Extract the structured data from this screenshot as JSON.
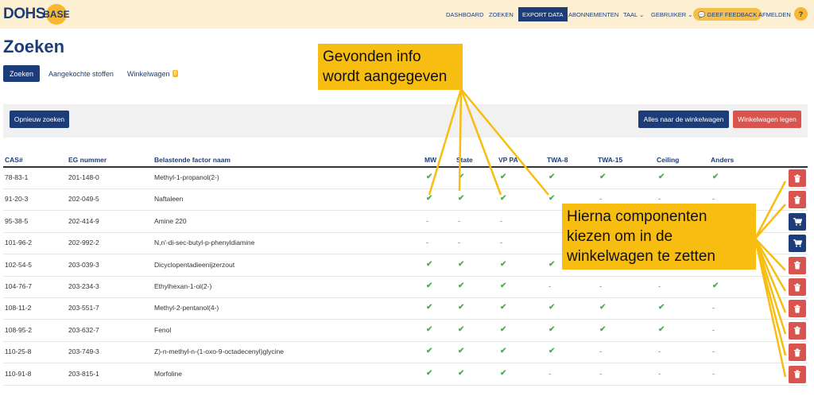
{
  "header": {
    "logo_left": "DOHS",
    "logo_middle": "BASE",
    "nav": [
      {
        "label": "DASHBOARD"
      },
      {
        "label": "ZOEKEN"
      },
      {
        "label": "EXPORT DATA"
      },
      {
        "label": "ABONNEMENTEN"
      },
      {
        "label": "TAAL ⌄"
      },
      {
        "label": "GEBRUIKER ⌄"
      },
      {
        "label": "💬 GEEF FEEDBACK"
      },
      {
        "label": "AFMELDEN"
      }
    ],
    "help": "?"
  },
  "page": {
    "title": "Zoeken"
  },
  "tabs": [
    {
      "label": "Zoeken"
    },
    {
      "label": "Aangekochte stoffen"
    },
    {
      "label": "Winkelwagen",
      "badge": "8"
    }
  ],
  "actions": {
    "new_search": "Opnieuw zoeken",
    "all_to_cart": "Alles naar de winkelwagen",
    "empty_cart": "Winkelwagen legen"
  },
  "columns": [
    "CAS#",
    "EG nummer",
    "Belastende factor naam",
    "MW",
    "State",
    "VP PA",
    "TWA-8",
    "TWA-15",
    "Ceiling",
    "Anders"
  ],
  "rows": [
    {
      "cas": "78-83-1",
      "eg": "201-148-0",
      "name": "Methyl-1-propanol(2-)",
      "flags": [
        "y",
        "y",
        "y",
        "y",
        "y",
        "y",
        "y"
      ],
      "action": "trash"
    },
    {
      "cas": "91-20-3",
      "eg": "202-049-5",
      "name": "Naftaleen",
      "flags": [
        "y",
        "y",
        "y",
        "y",
        "-",
        "-",
        "-"
      ],
      "action": "trash"
    },
    {
      "cas": "95-38-5",
      "eg": "202-414-9",
      "name": "Amine 220",
      "flags": [
        "-",
        "-",
        "-",
        "",
        "",
        "",
        ""
      ],
      "action": "cart"
    },
    {
      "cas": "101-96-2",
      "eg": "202-992-2",
      "name": "N,n'-di-sec-butyl-p-phenyldiamine",
      "flags": [
        "-",
        "-",
        "-",
        "",
        "",
        "",
        ""
      ],
      "action": "cart"
    },
    {
      "cas": "102-54-5",
      "eg": "203-039-3",
      "name": "Dicyclopentadieenijzerzout",
      "flags": [
        "y",
        "y",
        "y",
        "y",
        "",
        "",
        ""
      ],
      "action": "trash"
    },
    {
      "cas": "104-76-7",
      "eg": "203-234-3",
      "name": "Ethylhexan-1-ol(2-)",
      "flags": [
        "y",
        "y",
        "y",
        "-",
        "-",
        "-",
        "y"
      ],
      "action": "trash"
    },
    {
      "cas": "108-11-2",
      "eg": "203-551-7",
      "name": "Methyl-2-pentanol(4-)",
      "flags": [
        "y",
        "y",
        "y",
        "y",
        "y",
        "y",
        "-"
      ],
      "action": "trash"
    },
    {
      "cas": "108-95-2",
      "eg": "203-632-7",
      "name": "Fenol",
      "flags": [
        "y",
        "y",
        "y",
        "y",
        "y",
        "y",
        "-"
      ],
      "action": "trash"
    },
    {
      "cas": "110-25-8",
      "eg": "203-749-3",
      "name": "Z)-n-methyl-n-(1-oxo-9-octadecenyl)glycine",
      "flags": [
        "y",
        "y",
        "y",
        "y",
        "-",
        "-",
        "-"
      ],
      "action": "trash"
    },
    {
      "cas": "110-91-8",
      "eg": "203-815-1",
      "name": "Morfoline",
      "flags": [
        "y",
        "y",
        "y",
        "-",
        "-",
        "-",
        "-"
      ],
      "action": "trash"
    }
  ],
  "callouts": {
    "top": [
      "Gevonden info",
      "wordt aangegeven"
    ],
    "right": [
      "Hierna componenten",
      "kiezen om in de",
      "winkelwagen te zetten"
    ]
  },
  "colors": {
    "primary": "#1c3d7a",
    "danger": "#d9534f",
    "success": "#4caf50",
    "accent": "#f7b733",
    "callout": "#f7bd10"
  }
}
